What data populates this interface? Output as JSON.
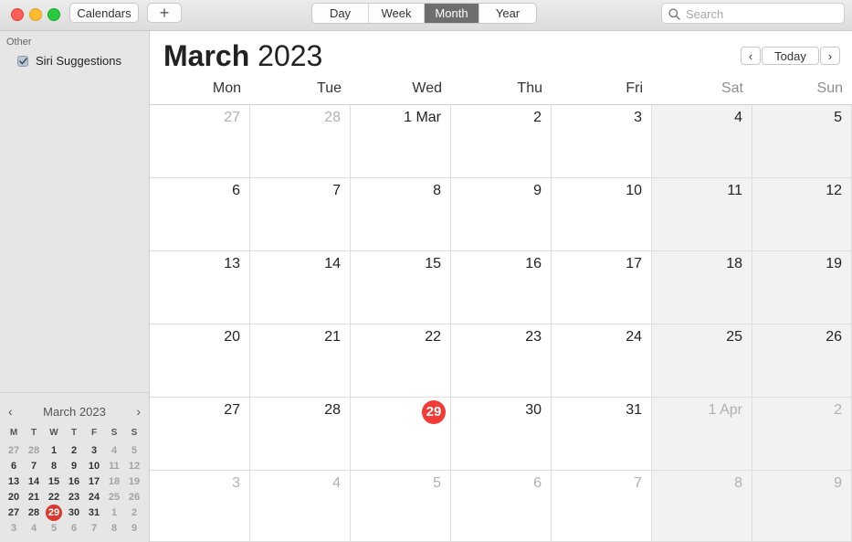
{
  "toolbar": {
    "calendars_label": "Calendars",
    "add_label": "+",
    "views": [
      "Day",
      "Week",
      "Month",
      "Year"
    ],
    "active_view": "Month",
    "search_placeholder": "Search"
  },
  "sidebar": {
    "section_label": "Other",
    "calendars": [
      {
        "label": "Siri Suggestions",
        "checked": true
      }
    ]
  },
  "mini_calendar": {
    "title": "March 2023",
    "prev_glyph": "‹",
    "next_glyph": "›",
    "dow": [
      "M",
      "T",
      "W",
      "T",
      "F",
      "S",
      "S"
    ],
    "weeks": [
      [
        {
          "d": "27",
          "dim": true
        },
        {
          "d": "28",
          "dim": true
        },
        {
          "d": "1"
        },
        {
          "d": "2"
        },
        {
          "d": "3"
        },
        {
          "d": "4",
          "dim": true
        },
        {
          "d": "5",
          "dim": true
        }
      ],
      [
        {
          "d": "6"
        },
        {
          "d": "7"
        },
        {
          "d": "8"
        },
        {
          "d": "9"
        },
        {
          "d": "10"
        },
        {
          "d": "11",
          "dim": true
        },
        {
          "d": "12",
          "dim": true
        }
      ],
      [
        {
          "d": "13"
        },
        {
          "d": "14"
        },
        {
          "d": "15"
        },
        {
          "d": "16"
        },
        {
          "d": "17"
        },
        {
          "d": "18",
          "dim": true
        },
        {
          "d": "19",
          "dim": true
        }
      ],
      [
        {
          "d": "20"
        },
        {
          "d": "21"
        },
        {
          "d": "22"
        },
        {
          "d": "23"
        },
        {
          "d": "24"
        },
        {
          "d": "25",
          "dim": true
        },
        {
          "d": "26",
          "dim": true
        }
      ],
      [
        {
          "d": "27"
        },
        {
          "d": "28"
        },
        {
          "d": "29",
          "today": true
        },
        {
          "d": "30"
        },
        {
          "d": "31"
        },
        {
          "d": "1",
          "dim": true
        },
        {
          "d": "2",
          "dim": true
        }
      ],
      [
        {
          "d": "3",
          "dim": true
        },
        {
          "d": "4",
          "dim": true
        },
        {
          "d": "5",
          "dim": true
        },
        {
          "d": "6",
          "dim": true
        },
        {
          "d": "7",
          "dim": true
        },
        {
          "d": "8",
          "dim": true
        },
        {
          "d": "9",
          "dim": true
        }
      ]
    ]
  },
  "main": {
    "month": "March",
    "year": "2023",
    "prev_glyph": "‹",
    "today_label": "Today",
    "next_glyph": "›",
    "dow": [
      "Mon",
      "Tue",
      "Wed",
      "Thu",
      "Fri",
      "Sat",
      "Sun"
    ],
    "weeks": [
      [
        {
          "d": "27",
          "dim": true
        },
        {
          "d": "28",
          "dim": true
        },
        {
          "d": "1 Mar"
        },
        {
          "d": "2"
        },
        {
          "d": "3"
        },
        {
          "d": "4"
        },
        {
          "d": "5"
        }
      ],
      [
        {
          "d": "6"
        },
        {
          "d": "7"
        },
        {
          "d": "8"
        },
        {
          "d": "9"
        },
        {
          "d": "10"
        },
        {
          "d": "11"
        },
        {
          "d": "12"
        }
      ],
      [
        {
          "d": "13"
        },
        {
          "d": "14"
        },
        {
          "d": "15"
        },
        {
          "d": "16"
        },
        {
          "d": "17"
        },
        {
          "d": "18"
        },
        {
          "d": "19"
        }
      ],
      [
        {
          "d": "20"
        },
        {
          "d": "21"
        },
        {
          "d": "22"
        },
        {
          "d": "23"
        },
        {
          "d": "24"
        },
        {
          "d": "25"
        },
        {
          "d": "26"
        }
      ],
      [
        {
          "d": "27"
        },
        {
          "d": "28"
        },
        {
          "d": "29",
          "today": true
        },
        {
          "d": "30"
        },
        {
          "d": "31"
        },
        {
          "d": "1 Apr",
          "dim": true
        },
        {
          "d": "2",
          "dim": true
        }
      ],
      [
        {
          "d": "3",
          "dim": true
        },
        {
          "d": "4",
          "dim": true
        },
        {
          "d": "5",
          "dim": true
        },
        {
          "d": "6",
          "dim": true
        },
        {
          "d": "7",
          "dim": true
        },
        {
          "d": "8",
          "dim": true
        },
        {
          "d": "9",
          "dim": true
        }
      ]
    ]
  },
  "colors": {
    "today_red": "#f23b36",
    "weekend_bg": "#f2f2f2",
    "active_segment": "#6e6e6e"
  }
}
